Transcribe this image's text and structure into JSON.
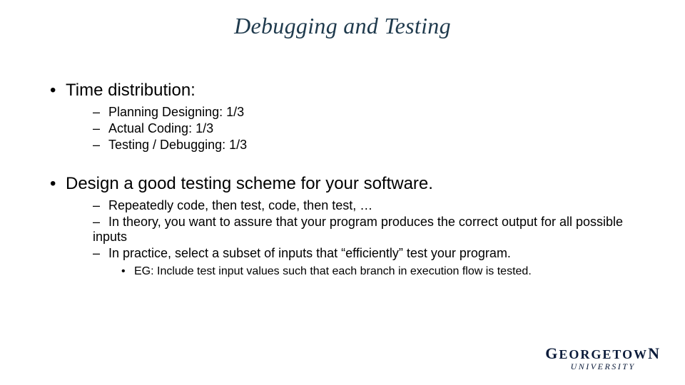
{
  "title": "Debugging and Testing",
  "s1": {
    "head": "Time distribution:",
    "a": "Planning Designing: 1/3",
    "b": "Actual Coding: 1/3",
    "c": "Testing / Debugging: 1/3"
  },
  "s2": {
    "head": "Design a good testing scheme for your software.",
    "a": "Repeatedly code, then test, code, then test, …",
    "b": "In theory, you want to assure that your program produces the correct output for all possible inputs",
    "c": "In practice, select a subset of inputs that “efficiently” test your program.",
    "c1": "EG: Include test input values such that each branch in execution flow is tested."
  },
  "logo": {
    "l1a": "G",
    "l1b": "EORGETOW",
    "l1c": "N",
    "l2": "UNIVERSITY"
  }
}
